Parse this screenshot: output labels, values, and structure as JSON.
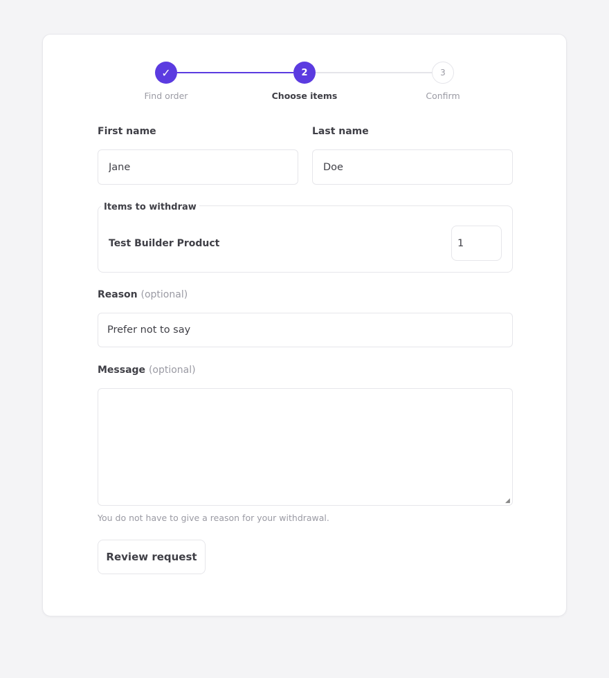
{
  "colors": {
    "accent": "#5b3be0",
    "inactive_line": "#e5e5ea",
    "inactive_text": "#9a9aa3",
    "active_text": "#3f3f46"
  },
  "stepper": {
    "steps": [
      {
        "marker": "✓",
        "label": "Find order",
        "state": "complete"
      },
      {
        "marker": "2",
        "label": "Choose items",
        "state": "active"
      },
      {
        "marker": "3",
        "label": "Confirm",
        "state": "upcoming"
      }
    ]
  },
  "form": {
    "first_name": {
      "label": "First name",
      "value": "Jane"
    },
    "last_name": {
      "label": "Last name",
      "value": "Doe"
    },
    "items": {
      "legend": "Items to withdraw",
      "rows": [
        {
          "name": "Test Builder Product",
          "quantity": "1"
        }
      ]
    },
    "reason": {
      "label": "Reason",
      "optional": "(optional)",
      "value": "Prefer not to say"
    },
    "message": {
      "label": "Message",
      "optional": "(optional)",
      "value": "",
      "hint": "You do not have to give a reason for your withdrawal."
    },
    "submit_label": "Review request"
  }
}
